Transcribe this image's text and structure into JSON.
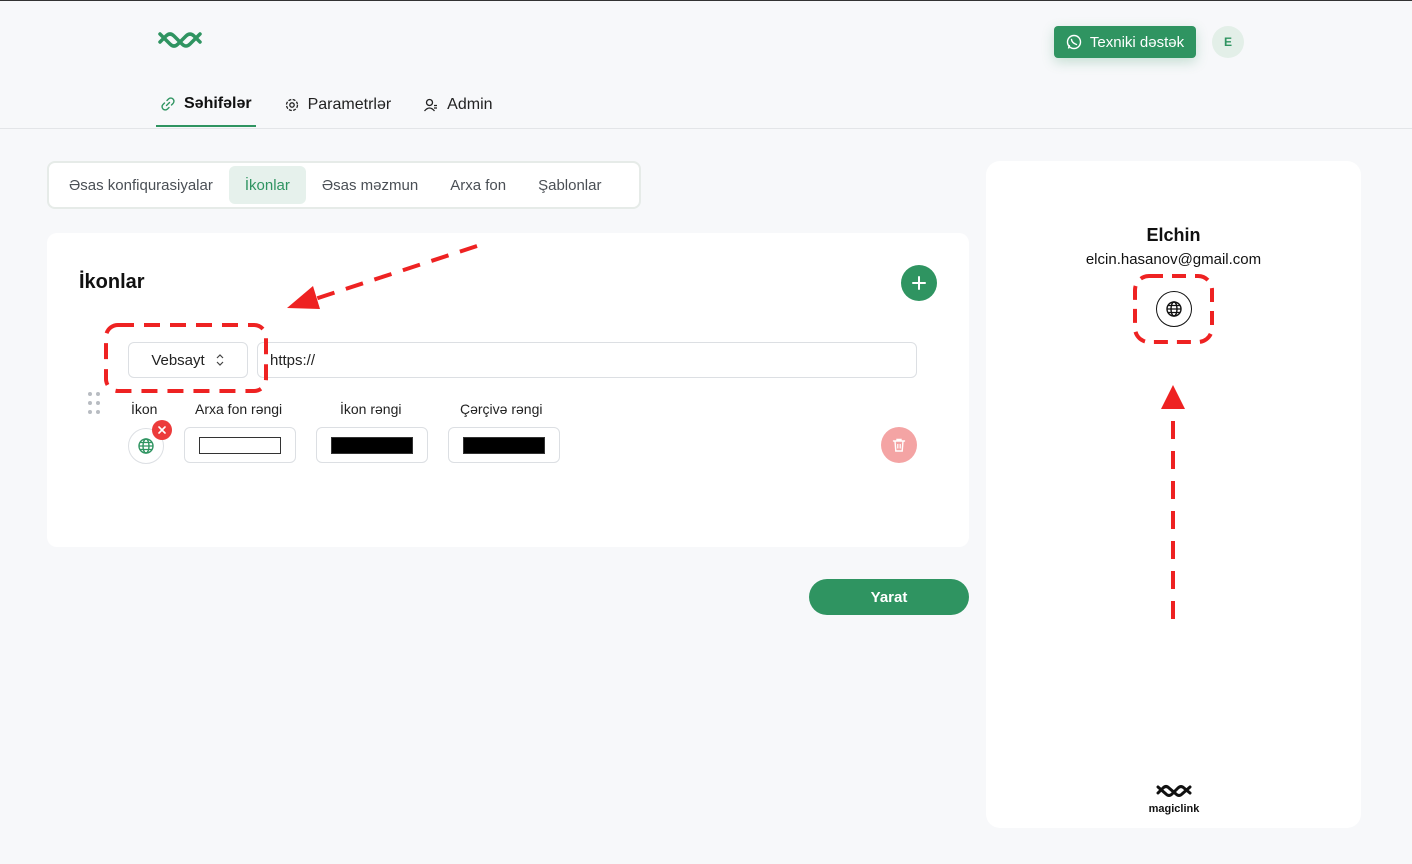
{
  "header": {
    "support_label": "Texniki dəstək",
    "avatar_initial": "E"
  },
  "nav": {
    "items": [
      {
        "label": "Səhifələr",
        "icon": "link-icon",
        "active": true
      },
      {
        "label": "Parametrlər",
        "icon": "gear-icon",
        "active": false
      },
      {
        "label": "Admin",
        "icon": "user-icon",
        "active": false
      }
    ]
  },
  "subtabs": {
    "items": [
      "Əsas konfiqurasiyalar",
      "İkonlar",
      "Əsas məzmun",
      "Arxa fon",
      "Şablonlar"
    ],
    "active": "İkonlar"
  },
  "icons_card": {
    "title": "İkonlar",
    "type_select_value": "Vebsayt",
    "url_value": "https://",
    "labels": {
      "icon": "İkon",
      "bg_color": "Arxa fon rəngi",
      "icon_color": "İkon rəngi",
      "border_color": "Çərçivə rəngi"
    },
    "colors": {
      "bg_color": "#ffffff",
      "icon_color": "#000000",
      "border_color": "#000000"
    }
  },
  "create_label": "Yarat",
  "preview": {
    "name": "Elchin",
    "email": "elcin.hasanov@gmail.com",
    "brand": "magiclink"
  },
  "colors": {
    "accent": "#2f9461",
    "danger": "#ec3b3b",
    "annotation": "#ee2222"
  }
}
